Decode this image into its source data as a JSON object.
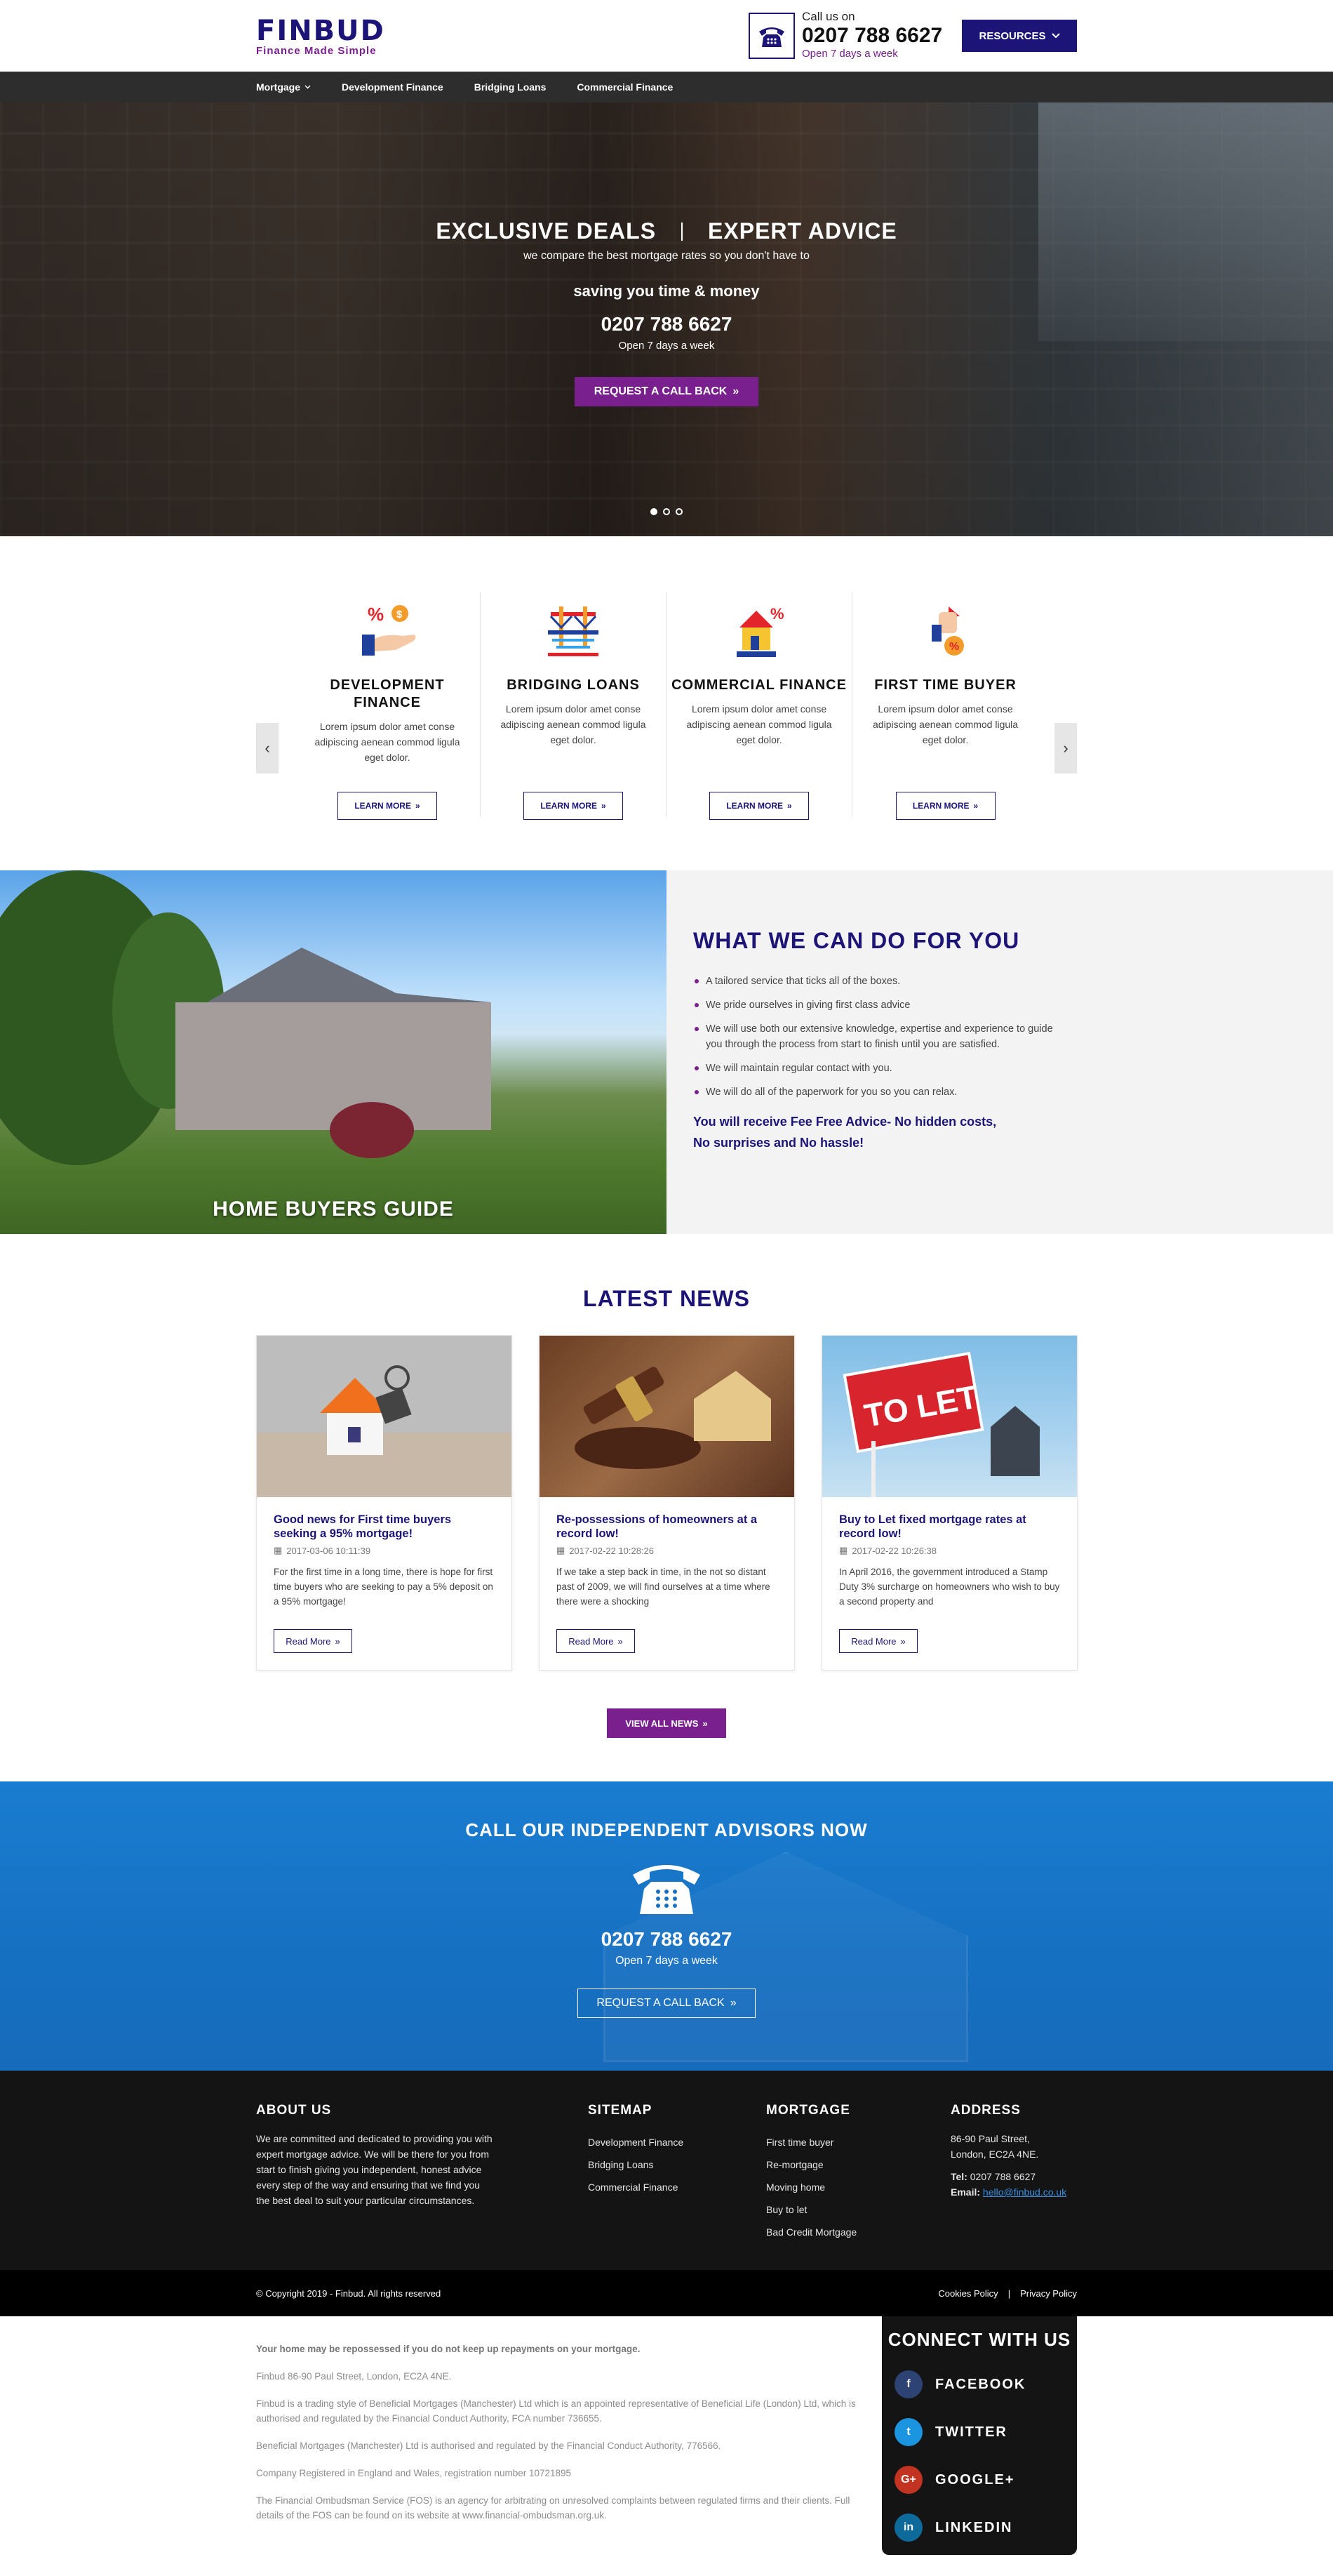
{
  "header": {
    "logo_word": "FINBUD",
    "logo_tagline": "Finance Made Simple",
    "call_label": "Call us on",
    "call_number": "0207 788 6627",
    "call_open": "Open 7 days a week",
    "resources_label": "RESOURCES"
  },
  "nav": {
    "items": [
      "Mortgage",
      "Development Finance",
      "Bridging Loans",
      "Commercial Finance"
    ]
  },
  "hero": {
    "title_left": "EXCLUSIVE DEALS",
    "title_right": "EXPERT ADVICE",
    "subtitle": "we compare the best mortgage rates so you don't have to",
    "saving": "saving you time & money",
    "phone": "0207 788 6627",
    "open": "Open 7 days a week",
    "button": "REQUEST A CALL BACK",
    "slides_total": 3,
    "active_slide": 1
  },
  "services": [
    {
      "title": "DEVELOPMENT FINANCE",
      "text": "Lorem ipsum dolor amet conse adipiscing aenean commod ligula eget dolor.",
      "button": "LEARN MORE",
      "icon": "hand-money-icon"
    },
    {
      "title": "BRIDGING LOANS",
      "text": "Lorem ipsum dolor amet conse adipiscing aenean commod ligula eget dolor.",
      "button": "LEARN MORE",
      "icon": "bridge-icon"
    },
    {
      "title": "COMMERCIAL FINANCE",
      "text": "Lorem ipsum dolor amet conse adipiscing aenean commod ligula eget dolor.",
      "button": "LEARN MORE",
      "icon": "shop-icon"
    },
    {
      "title": "FIRST TIME BUYER",
      "text": "Lorem ipsum dolor amet conse adipiscing aenean commod ligula eget dolor.",
      "button": "LEARN MORE",
      "icon": "hand-house-icon"
    }
  ],
  "what": {
    "image_label": "HOME BUYERS GUIDE",
    "title": "WHAT WE CAN DO FOR YOU",
    "items": [
      "A tailored service that ticks all of the boxes.",
      "We pride ourselves in giving first class advice",
      "We will use both our extensive knowledge, expertise and experience to guide you through the process from start to finish until you are satisfied.",
      "We will maintain regular contact with you.",
      "We will do all of the paperwork for you so you can relax."
    ],
    "note_line1": "You will receive Fee Free Advice- No hidden costs,",
    "note_line2": "No surprises and No hassle!"
  },
  "news": {
    "title": "LATEST NEWS",
    "items": [
      {
        "title": "Good news for First time buyers seeking a 95% mortgage!",
        "date": "2017-03-06 10:11:39",
        "text": "For the first time in a long time, there is hope for first time buyers who are seeking to pay a 5% deposit on a 95% mortgage!",
        "button": "Read More"
      },
      {
        "title": "Re-possessions of homeowners at a record low!",
        "date": "2017-02-22 10:28:26",
        "text": "If we take a step back in time, in the not so distant past of 2009, we will find ourselves at a time where there were a shocking",
        "button": "Read More"
      },
      {
        "title": "Buy to Let fixed mortgage rates at record low!",
        "date": "2017-02-22 10:26:38",
        "text": "In April 2016, the government introduced a Stamp Duty 3% surcharge on homeowners who wish to buy a second property and",
        "button": "Read More",
        "sign": "TO LET"
      }
    ],
    "view_all": "VIEW ALL NEWS"
  },
  "cta": {
    "title": "CALL OUR INDEPENDENT ADVISORS NOW",
    "phone": "0207 788 6627",
    "open": "Open 7 days a week",
    "button": "REQUEST A CALL BACK"
  },
  "footer": {
    "about_title": "ABOUT US",
    "about_text": "We are committed and dedicated to providing you with expert mortgage advice. We will be there for you from start to finish giving you independent, honest advice every step of the way and ensuring that we find you the best deal to suit your particular circumstances.",
    "sitemap_title": "SITEMAP",
    "sitemap_links": [
      "Development Finance",
      "Bridging Loans",
      "Commercial Finance"
    ],
    "mortgage_title": "MORTGAGE",
    "mortgage_links": [
      "First time buyer",
      "Re-mortgage",
      "Moving home",
      "Buy to let",
      "Bad Credit Mortgage"
    ],
    "address_title": "ADDRESS",
    "address_line1": "86-90 Paul Street,",
    "address_line2": "London, EC2A 4NE.",
    "tel_label": "Tel:",
    "tel": "0207 788 6627",
    "email_label": "Email:",
    "email": "hello@finbud.co.uk",
    "copyright": "© Copyright 2019 - Finbud. All rights reserved",
    "cookies": "Cookies Policy",
    "divider": "|",
    "privacy": "Privacy Policy"
  },
  "legal": {
    "warning": "Your home may be repossessed if you do not keep up repayments on your mortgage.",
    "address": "Finbud 86-90 Paul Street, London, EC2A 4NE.",
    "trading": "Finbud is a trading style of Beneficial Mortgages (Manchester) Ltd which is an appointed representative of Beneficial Life (London) Ltd, which is authorised and regulated by the Financial Conduct Authority, FCA number 736655.",
    "authorised": "Beneficial Mortgages (Manchester) Ltd is authorised and regulated by the Financial Conduct Authority, 776566.",
    "registered": "Company Registered in England and Wales, registration number 10721895",
    "fos": "The Financial Ombudsman Service (FOS) is an agency for arbitrating on unresolved complaints between regulated firms and their clients. Full details of the FOS can be found on its website at www.financial-ombudsman.org.uk."
  },
  "connect": {
    "title": "CONNECT WITH US",
    "networks": [
      {
        "label": "FACEBOOK",
        "glyph": "f",
        "color": "#2d4373"
      },
      {
        "label": "TWITTER",
        "glyph": "t",
        "color": "#1b95e0"
      },
      {
        "label": "GOOGLE+",
        "glyph": "G+",
        "color": "#c23321"
      },
      {
        "label": "LINKEDIN",
        "glyph": "in",
        "color": "#0e6a9a"
      }
    ]
  },
  "colors": {
    "brand": "#1c1577",
    "accent": "#7a1f8e",
    "cta_blue": "#1670c2"
  }
}
